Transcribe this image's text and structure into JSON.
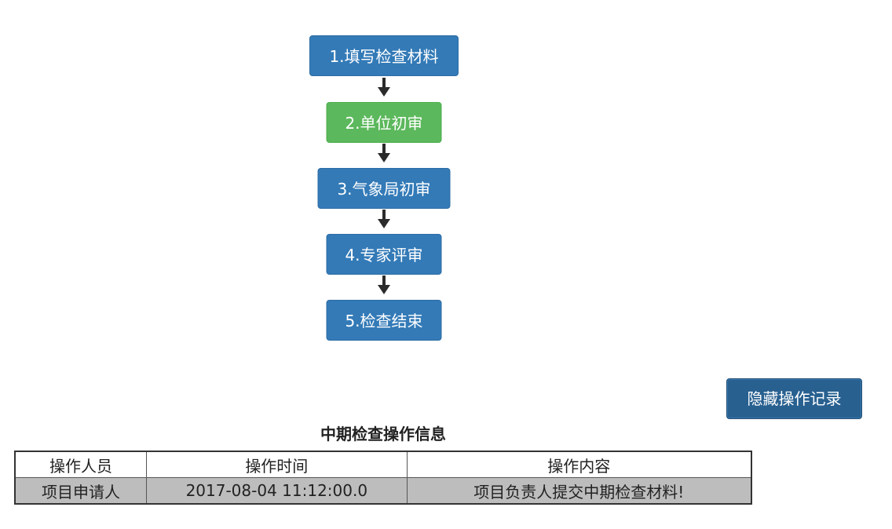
{
  "flow": {
    "steps": [
      {
        "label": "1.填写检查材料",
        "color": "#337ab7"
      },
      {
        "label": "2.单位初审",
        "color": "#5cb85c"
      },
      {
        "label": "3.气象局初审",
        "color": "#337ab7"
      },
      {
        "label": "4.专家评审",
        "color": "#337ab7"
      },
      {
        "label": "5.检查结束",
        "color": "#337ab7"
      }
    ]
  },
  "toggle_button": {
    "label": "隐藏操作记录"
  },
  "log_section": {
    "title": "中期检查操作信息",
    "columns": [
      "操作人员",
      "操作时间",
      "操作内容"
    ],
    "rows": [
      [
        "项目申请人",
        "2017-08-04 11:12:00.0",
        "项目负责人提交中期检查材料!"
      ]
    ]
  }
}
